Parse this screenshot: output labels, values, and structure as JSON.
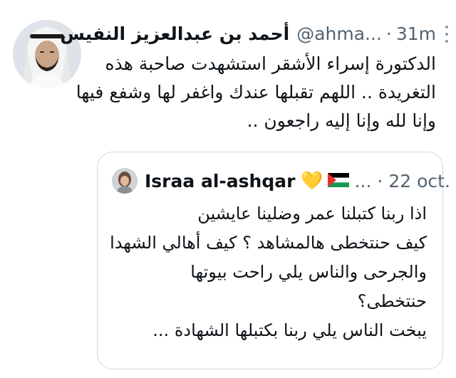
{
  "tweet": {
    "author_name": "أحمد بن عبدالعزيز النفيس",
    "handle": "@ahma...",
    "separator": "·",
    "time": "31m",
    "text_lines": [
      "الدكتورة إسراء الأشقر استشهدت صاحبة هذه",
      "التغريدة .. اللهم تقبلها عندك واغفر لها وشفع فيها",
      "وإنا لله وإنا إليه راجعون .."
    ]
  },
  "quoted_tweet": {
    "author_name": "Israa al-ashqar",
    "emoji_heart": "💛",
    "handle": "...",
    "separator": "·",
    "time": "22 oct.",
    "text_lines": [
      "اذا ربنا كتبلنا عمر وضلينا عايشين",
      "كيف حنتخطى هالمشاهد ؟ كيف أهالي الشهدا",
      "والجرحى والناس يلي راحت بيوتها",
      "حنتخطى؟",
      "يبخت الناس يلي ربنا بكتبلها الشهادة ..."
    ]
  },
  "icons": {
    "more": "more-vertical-icon",
    "flag": "palestine-flag-icon"
  },
  "colors": {
    "text": "#0f1419",
    "secondary": "#536471",
    "border": "#cfd9de",
    "flag_black": "#000000",
    "flag_white": "#ffffff",
    "flag_green": "#149954",
    "flag_red": "#e4312b"
  }
}
